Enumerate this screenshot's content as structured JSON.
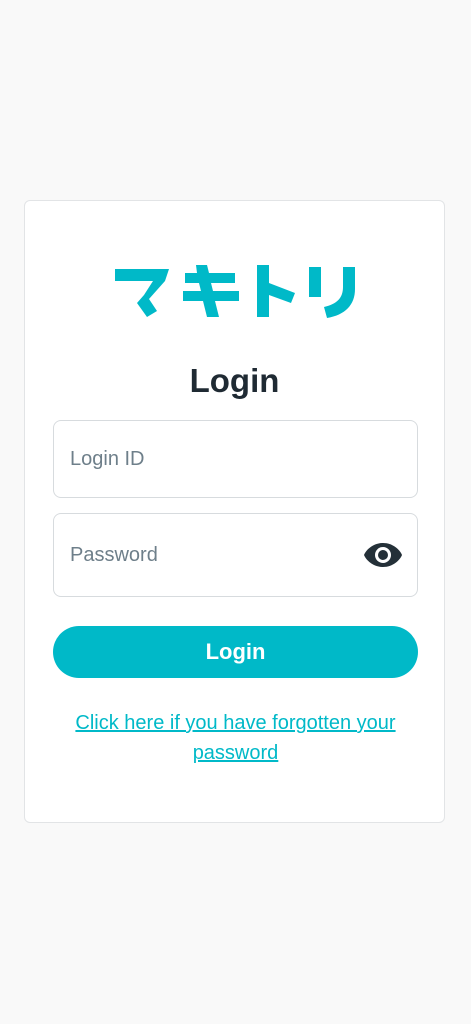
{
  "colors": {
    "accent": "#00b9c8",
    "title": "#1f2a33",
    "placeholder": "#6e7f8a",
    "background": "#f9f9f9"
  },
  "logo": {
    "text": "マキトリ",
    "icon": "brand-logo"
  },
  "login": {
    "title": "Login",
    "login_id": {
      "placeholder": "Login ID",
      "value": ""
    },
    "password": {
      "placeholder": "Password",
      "value": "",
      "toggle_icon": "eye-icon"
    },
    "submit_label": "Login",
    "forgot_link": "Click here if you have forgotten your password"
  }
}
